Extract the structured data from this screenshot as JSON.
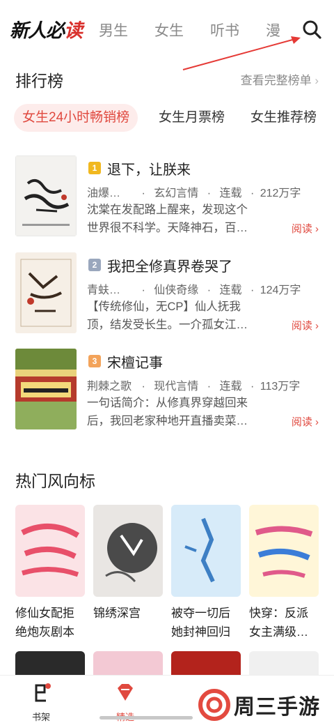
{
  "app": {
    "logo_text_a": "新人",
    "logo_text_b": "必",
    "logo_text_c": "读"
  },
  "nav": {
    "tabs": [
      "男生",
      "女生",
      "听书",
      "漫"
    ]
  },
  "ranking": {
    "title": "排行榜",
    "more": "查看完整榜单",
    "tabs": [
      "女生24小时畅销榜",
      "女生月票榜",
      "女生推荐榜"
    ],
    "books": [
      {
        "rank": "1",
        "rank_color": "#f1b81f",
        "title": "退下，让朕来",
        "author": "油爆…",
        "category": "玄幻言情",
        "status": "连载",
        "words": "212万字",
        "desc1": "沈棠在发配路上醒来，发现这个",
        "desc2": "世界很不科学。天降神石，百…",
        "read": "阅读 ›"
      },
      {
        "rank": "2",
        "rank_color": "#9aa7bd",
        "title": "我把全修真界卷哭了",
        "author": "青蚨…",
        "category": "仙侠奇缘",
        "status": "连载",
        "words": "124万字",
        "desc1": "【传统修仙，无CP】仙人抚我",
        "desc2": "顶，结发受长生。一介孤女江…",
        "read": "阅读 ›"
      },
      {
        "rank": "3",
        "rank_color": "#f3a35a",
        "title": "宋檀记事",
        "author": "荆棘之歌",
        "category": "现代言情",
        "status": "连载",
        "words": "113万字",
        "desc1": "一句话简介：从修真界穿越回来",
        "desc2": "后，我回老家种地开直播卖菜…",
        "read": "阅读 ›"
      }
    ]
  },
  "hot": {
    "title": "热门风向标",
    "books": [
      {
        "t1": "修仙女配拒",
        "t2": "绝炮灰剧本"
      },
      {
        "t1": "锦绣深宫",
        "t2": ""
      },
      {
        "t1": "被夺一切后",
        "t2": "她封神回归"
      },
      {
        "t1": "快穿：反派",
        "t2": "女主满级…"
      }
    ]
  },
  "tabbar": {
    "bookshelf": "书架",
    "featured": "精选"
  },
  "watermark": {
    "text": "周三手游网"
  },
  "colors": {
    "accent": "#e0493f",
    "annotation_arrow": "#e53935"
  }
}
